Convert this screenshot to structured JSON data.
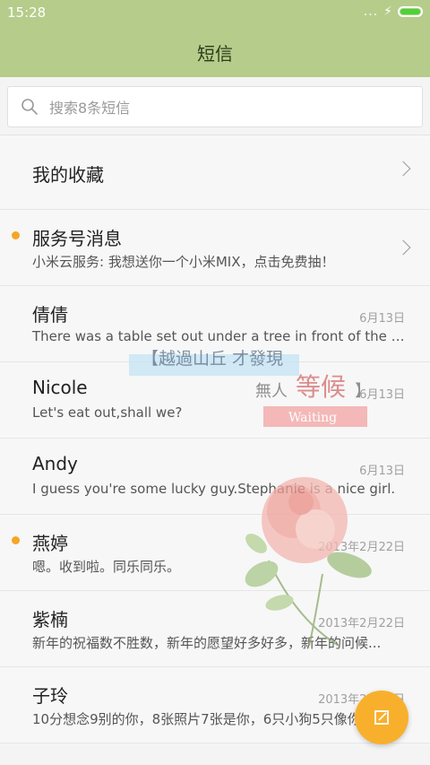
{
  "status_bar": {
    "time": "15:28",
    "dots": "...",
    "bolt": "⚡"
  },
  "header": {
    "title": "短信"
  },
  "search": {
    "placeholder": "搜索8条短信"
  },
  "favorites": {
    "label": "我的收藏"
  },
  "messages": [
    {
      "name": "服务号消息",
      "preview": "小米云服务: 我想送你一个小米MIX，点击免费抽！",
      "date": "",
      "unread": true,
      "chevron": true
    },
    {
      "name": "倩倩",
      "preview": "There was a table set out under a tree in front of the ho...",
      "date": "6月13日",
      "unread": false
    },
    {
      "name": "Nicole",
      "preview": "Let's eat out,shall we?",
      "date": "6月13日",
      "unread": false
    },
    {
      "name": "Andy",
      "preview": "I guess you're some lucky guy.Stephanie is a nice girl.",
      "date": "6月13日",
      "unread": false
    },
    {
      "name": "燕婷",
      "preview": "嗯。收到啦。同乐同乐。",
      "date": "2013年2月22日",
      "unread": true
    },
    {
      "name": "紫楠",
      "preview": "新年的祝福数不胜数，新年的愿望好多好多，新年的问候...",
      "date": "2013年2月22日",
      "unread": false
    },
    {
      "name": "子玲",
      "preview": "10分想念9别的你，8张照片7张是你，6只小狗5只像你...",
      "date": "2013年2月22日",
      "unread": false
    }
  ],
  "wallpaper": {
    "line1": "【越過山丘 才發現",
    "line2": "無人",
    "line3": "等候",
    "line4": "】",
    "line5": "Waiting"
  },
  "compose": {
    "icon": "compose-icon"
  },
  "colors": {
    "header": "#b6cc8b",
    "accent": "#f8b02c",
    "unread_dot": "#f5a623"
  }
}
